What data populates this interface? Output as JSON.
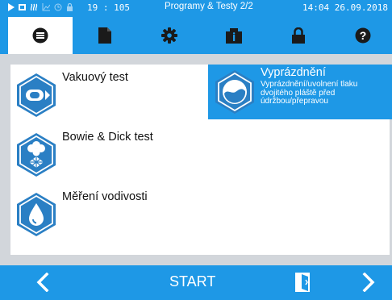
{
  "status_bar": {
    "counter": "19 : 105",
    "title": "Programy & Testy 2/2",
    "datetime": "14:04 26.09.2018",
    "icons": [
      "play-icon",
      "cycle-icon",
      "steam-icon",
      "graph-icon",
      "clock-icon",
      "lock-icon"
    ]
  },
  "tabs": [
    {
      "name": "list",
      "icon": "list-icon",
      "active": true
    },
    {
      "name": "document",
      "icon": "document-icon"
    },
    {
      "name": "settings",
      "icon": "gear-icon"
    },
    {
      "name": "info",
      "icon": "info-icon"
    },
    {
      "name": "lock",
      "icon": "lock-icon"
    },
    {
      "name": "help",
      "icon": "help-icon"
    }
  ],
  "programs": [
    {
      "label": "Vakuový test",
      "icon": "vacuum-test-icon"
    },
    {
      "label": "Bowie & Dick test",
      "icon": "bowie-dick-icon"
    },
    {
      "label": "Měření vodivosti",
      "icon": "conductivity-icon"
    }
  ],
  "selected_program": {
    "title": "Vyprázdnění",
    "description": "Vyprázdnění/uvolnení tlaku dvojitého pláště před údržbou/přepravou",
    "icon": "drain-icon"
  },
  "bottom_bar": {
    "start_label": "START",
    "icons": [
      "chevron-left-icon",
      "door-icon",
      "chevron-right-icon"
    ]
  },
  "colors": {
    "accent": "#1e98e6",
    "icon_blue": "#2a7fc4",
    "background": "#d2d6db"
  }
}
